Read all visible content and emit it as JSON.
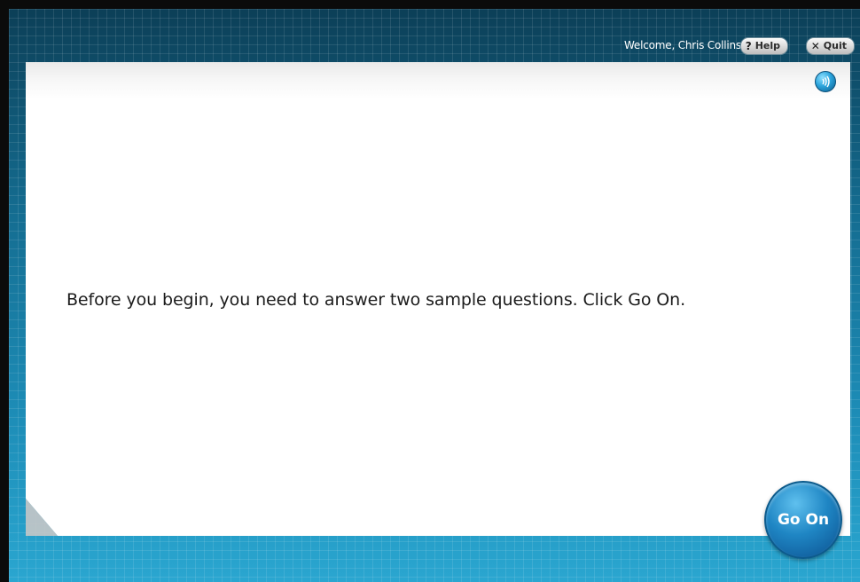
{
  "header": {
    "welcome_text": "Welcome, Chris Collins",
    "help_label": "Help",
    "quit_label": "Quit",
    "help_icon": "question-mark-icon",
    "quit_icon": "x-icon"
  },
  "panel": {
    "audio_icon": "speaker-icon",
    "instruction_text": "Before you begin, you need to answer two sample questions. Click Go On."
  },
  "footer": {
    "go_on_label": "Go On"
  },
  "colors": {
    "background_top": "#0c3f57",
    "background_bottom": "#2aa6d0",
    "panel": "#ffffff",
    "button_blue": "#1f86c4"
  }
}
